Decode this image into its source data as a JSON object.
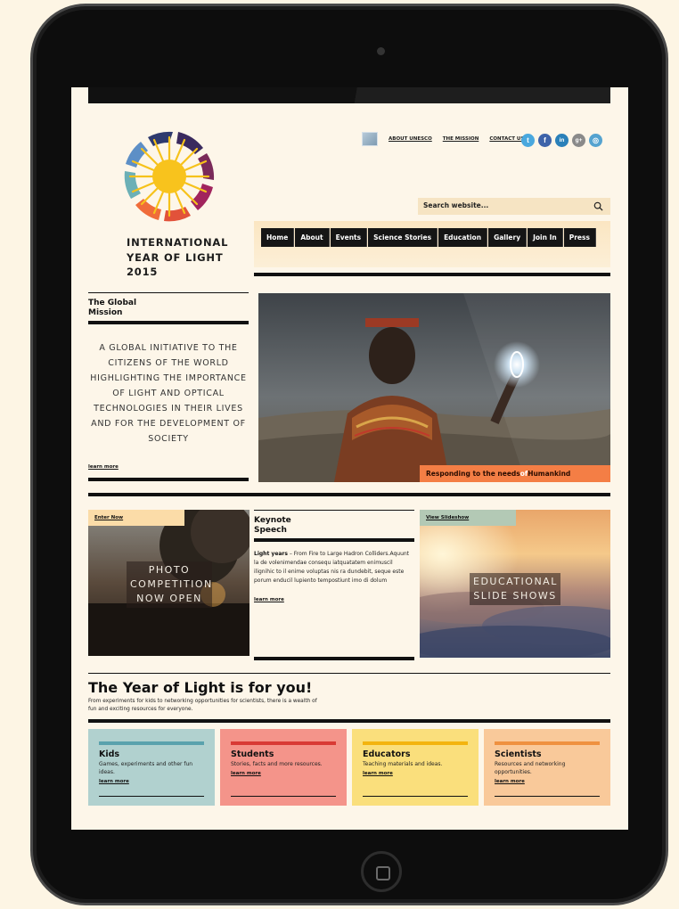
{
  "site": {
    "org_name_lines": [
      "INTERNATIONAL",
      "YEAR OF LIGHT",
      "2015"
    ]
  },
  "top_links": [
    "ABOUT UNESCO",
    "THE MISSION",
    "CONTACT US"
  ],
  "social_icons": [
    {
      "name": "twitter-icon",
      "glyph": "t",
      "color": "#4aa8de"
    },
    {
      "name": "facebook-icon",
      "glyph": "f",
      "color": "#3e63a9"
    },
    {
      "name": "linkedin-icon",
      "glyph": "in",
      "color": "#2a80b9"
    },
    {
      "name": "googleplus-icon",
      "glyph": "g+",
      "color": "#8a8a8a"
    },
    {
      "name": "instagram-icon",
      "glyph": "◎",
      "color": "#55a3d0"
    }
  ],
  "search": {
    "placeholder": "Search website..."
  },
  "nav": [
    "Home",
    "About",
    "Events",
    "Science Stories",
    "Education",
    "Gallery",
    "Join In",
    "Press"
  ],
  "mission": {
    "title": "The Global Mission",
    "text": "A GLOBAL INITIATIVE TO THE CITIZENS OF THE WORLD HIGHLIGHTING THE IMPORTANCE OF LIGHT AND OPTICAL TECHNOLOGIES IN THEIR LIVES AND FOR THE DEVELOPMENT OF SOCIETY",
    "learn_more": "learn more"
  },
  "hero": {
    "caption_prefix": "Responding to the needs ",
    "caption_of": "of",
    "caption_suffix": " Humankind"
  },
  "photo": {
    "tag": "Enter Now",
    "tag_color": "#fbdca8",
    "label_lines": [
      "PHOTO",
      "COMPETITION",
      "NOW OPEN"
    ]
  },
  "keynote": {
    "title": "Keynote Speech",
    "lead": "Light years",
    "body": " – From Fire to Large Hadron Colliders.Aquunt la de volenimendae consequ iatquatatem enimuscil ilignihic to il enime voluptas nis ra dundebit, seque este porum enducil lupiento tempostiunt imo di dolum",
    "learn_more": "learn more"
  },
  "slides": {
    "tag": "View Slideshow",
    "tag_color": "#b3c9b5",
    "label_lines": [
      "EDUCATIONAL",
      "SLIDE SHOWS"
    ]
  },
  "year_of_light": {
    "title": "The Year of Light is for you!",
    "subtitle": "From experiments for kids to networking opportunities for scientists, there is a wealth of fun and exciting resources for everyone."
  },
  "cards": [
    {
      "title": "Kids",
      "desc": "Games, experiments and other fun ideas.",
      "link": "learn more",
      "bg": "#b1d1cf",
      "bar": "#5aa2ad"
    },
    {
      "title": "Students",
      "desc": "Stories, facts and more resources.",
      "link": "learn more",
      "bg": "#f4948a",
      "bar": "#d93a35"
    },
    {
      "title": "Educators",
      "desc": "Teaching materials and ideas.",
      "link": "learn more",
      "bg": "#fadf7c",
      "bar": "#f3b40f"
    },
    {
      "title": "Scientists",
      "desc": "Resources and networking opportunities.",
      "link": "learn more",
      "bg": "#f9c99a",
      "bar": "#ef9140"
    }
  ]
}
